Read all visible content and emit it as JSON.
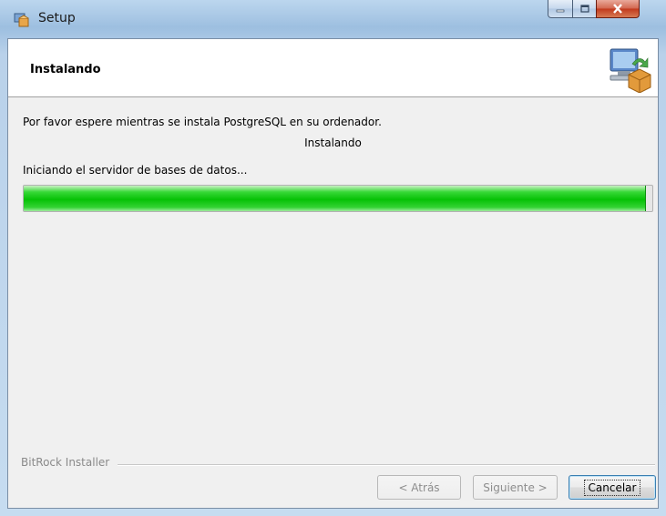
{
  "window": {
    "title": "Setup"
  },
  "header": {
    "title": "Instalando",
    "icon": "installer-box-icon"
  },
  "body": {
    "message": "Por favor espere mientras se instala PostgreSQL en su ordenador.",
    "status": "Instalando",
    "detail": "Iniciando el servidor de bases de datos...",
    "progress": 0.99
  },
  "footer": {
    "brand": "BitRock Installer",
    "back_label": "< Atrás",
    "next_label": "Siguiente >",
    "cancel_label": "Cancelar"
  },
  "colors": {
    "progress_green": "#06c106",
    "close_button": "#c1381c"
  }
}
